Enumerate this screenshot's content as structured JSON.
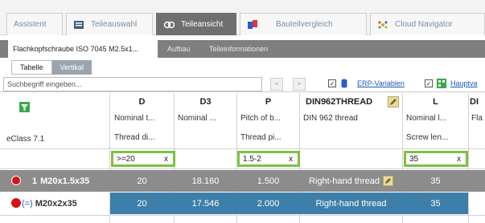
{
  "top_tabs": [
    {
      "label": "Assistent",
      "icon": null
    },
    {
      "label": "Teileauswahl",
      "icon": "list-icon"
    },
    {
      "label": "Teileansicht",
      "icon": "link-icon"
    },
    {
      "label": "Bauteilvergleich",
      "icon": "compare-icon"
    },
    {
      "label": "Cloud Navigator",
      "icon": "cloud-icon"
    }
  ],
  "sub_tabs": [
    "Flachkopfschraube ISO 7045 M2.5x1...",
    "Aufbau",
    "Teileinformationen"
  ],
  "view_tabs": [
    "Tabelle",
    "Vertikal"
  ],
  "search": {
    "placeholder": "Suchbegriff eingeben..."
  },
  "toolbar": {
    "erp_label": "ERP-Variablen",
    "main_label": "Hauptva"
  },
  "row_label": "eClass 7.1",
  "columns": [
    {
      "key": "D",
      "desc": "Nominal t...",
      "desc2": "Thread di...",
      "filter": ">=20"
    },
    {
      "key": "D3",
      "desc": "Nominal ...",
      "desc2": "",
      "filter": ""
    },
    {
      "key": "P",
      "desc": "Pitch of b...",
      "desc2": "Thread pi...",
      "filter": "1.5-2"
    },
    {
      "key": "DIN962THREAD",
      "desc": "DIN 962 thread",
      "desc2": "",
      "filter": ""
    },
    {
      "key": "L",
      "desc": "Nominal l...",
      "desc2": "Screw len...",
      "filter": "35"
    },
    {
      "key": "DI",
      "desc": "Fla",
      "desc2": "",
      "filter": ""
    }
  ],
  "filter_clear": "x",
  "rows": [
    {
      "index": "1",
      "name": "M20x1.5x35",
      "marker": "",
      "D": "20",
      "D3": "18.160",
      "P": "1.500",
      "DIN962THREAD": "Right-hand thread",
      "L": "35"
    },
    {
      "index": "",
      "name": "M20x2x35",
      "marker": "(=)",
      "D": "20",
      "D3": "17.546",
      "P": "2.000",
      "DIN962THREAD": "Right-hand thread",
      "L": "35"
    }
  ],
  "colors": {
    "highlight": "#7dc142",
    "selected_row": "#8c8c8c",
    "value_cells": "#3d7fa8",
    "status_dot": "#d41414"
  }
}
